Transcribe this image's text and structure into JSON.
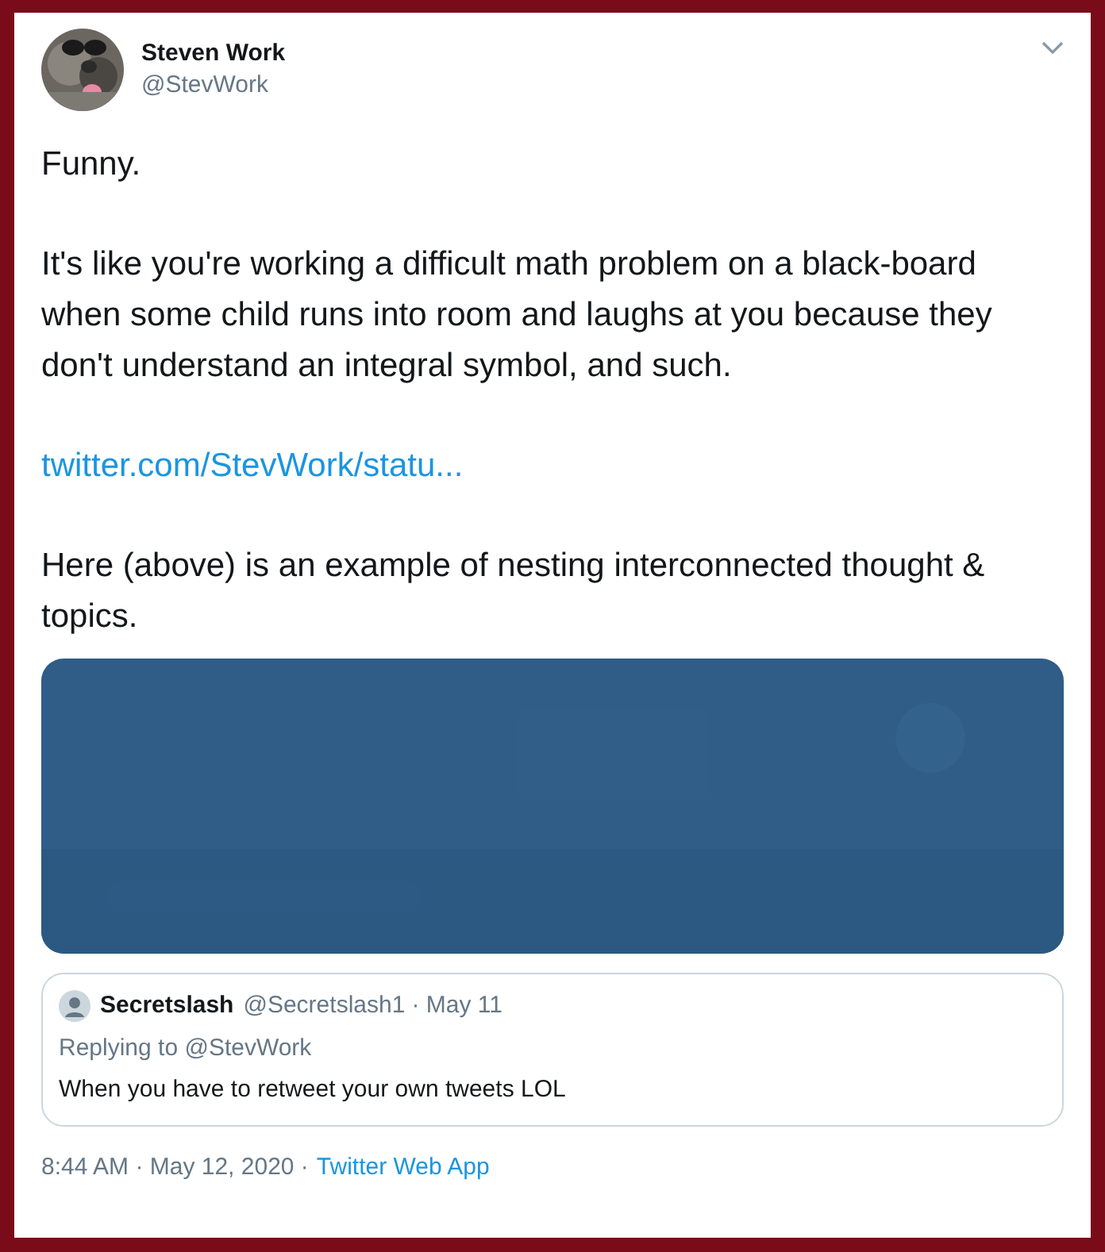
{
  "tweet": {
    "author": {
      "name": "Steven Work",
      "handle": "@StevWork"
    },
    "paragraphs": [
      "Funny.",
      "It's like you're working a difficult math problem on a black-board when some child runs into room and laughs at you because they don't understand an integral symbol, and such."
    ],
    "link": "twitter.com/StevWork/statu...",
    "closing": "Here (above) is an example of nesting interconnected thought & topics.",
    "quote": {
      "name": "Secretslash",
      "handle": "@Secretslash1",
      "date": "· May 11",
      "replying": "Replying to @StevWork",
      "text": "When you have to retweet your own tweets LOL"
    },
    "timestamp": "8:44 AM · May 12, 2020 ·",
    "source": "Twitter Web App"
  }
}
